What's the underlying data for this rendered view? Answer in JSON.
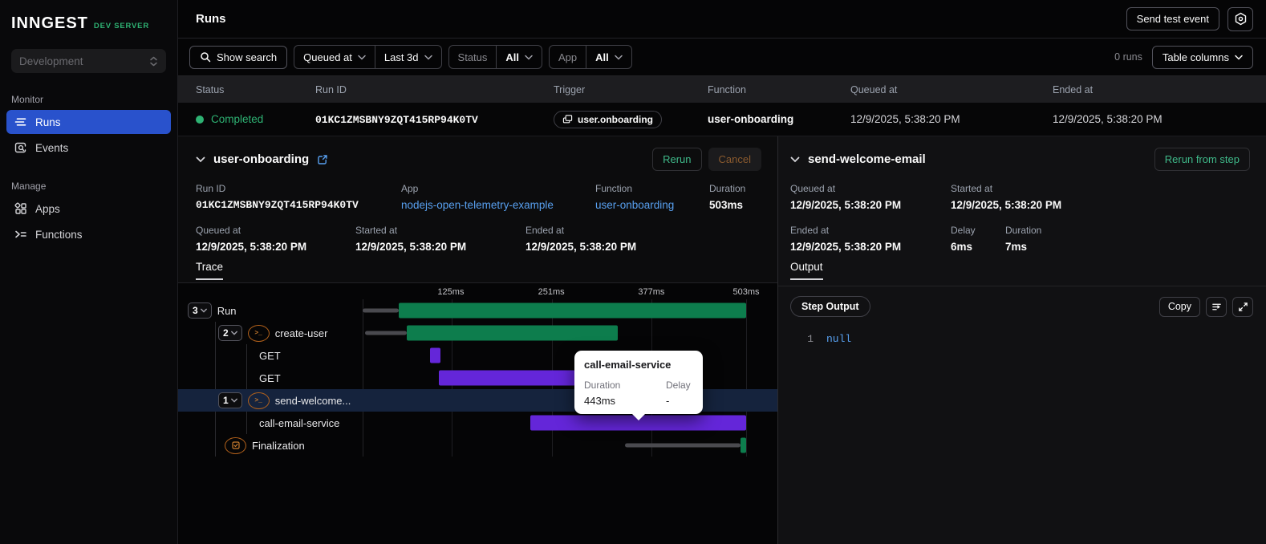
{
  "colors": {
    "accent_green": "#2eb273",
    "bar_green": "#0d7d4d",
    "bar_purple": "#6426d9",
    "link_blue": "#58a0f0",
    "active_blue": "#2952cc",
    "highlight_row": "#15233d"
  },
  "sidebar": {
    "logo": "INNGEST",
    "env": "DEV SERVER",
    "workspace": "Development",
    "sections": [
      {
        "label": "Monitor",
        "items": [
          {
            "label": "Runs",
            "active": true
          },
          {
            "label": "Events",
            "active": false
          }
        ]
      },
      {
        "label": "Manage",
        "items": [
          {
            "label": "Apps",
            "active": false
          },
          {
            "label": "Functions",
            "active": false
          }
        ]
      }
    ]
  },
  "topbar": {
    "title": "Runs",
    "send_test_event": "Send test event"
  },
  "filters": {
    "show_search": "Show search",
    "field": "Queued at",
    "range": "Last 3d",
    "status_label": "Status",
    "status_value": "All",
    "app_label": "App",
    "app_value": "All",
    "runs_count": "0 runs",
    "table_columns": "Table columns"
  },
  "table": {
    "columns": [
      "Status",
      "Run ID",
      "Trigger",
      "Function",
      "Queued at",
      "Ended at"
    ],
    "row": {
      "status": "Completed",
      "run_id": "01KC1ZMSBNY9ZQT415RP94K0TV",
      "trigger": "user.onboarding",
      "function": "user-onboarding",
      "queued_at": "12/9/2025, 5:38:20 PM",
      "ended_at": "12/9/2025, 5:38:20 PM"
    }
  },
  "run_details": {
    "title": "user-onboarding",
    "rerun": "Rerun",
    "cancel": "Cancel",
    "run_id_label": "Run ID",
    "run_id": "01KC1ZMSBNY9ZQT415RP94K0TV",
    "app_label": "App",
    "app": "nodejs-open-telemetry-example",
    "function_label": "Function",
    "function": "user-onboarding",
    "duration_label": "Duration",
    "duration": "503ms",
    "queued_label": "Queued at",
    "queued": "12/9/2025, 5:38:20 PM",
    "started_label": "Started at",
    "started": "12/9/2025, 5:38:20 PM",
    "ended_label": "Ended at",
    "ended": "12/9/2025, 5:38:20 PM",
    "tab": "Trace"
  },
  "trace": {
    "ticks": [
      {
        "label": "125ms",
        "pct": 23.0
      },
      {
        "label": "251ms",
        "pct": 49.2
      },
      {
        "label": "377ms",
        "pct": 75.3
      },
      {
        "label": "503ms",
        "pct": 100
      }
    ],
    "rows": [
      {
        "name": "Run",
        "depth": 0,
        "badge": "3",
        "icon": null,
        "highlight": false,
        "segments": [
          {
            "kind": "queue",
            "start": 0,
            "end": 9.4
          },
          {
            "kind": "green",
            "start": 9.4,
            "end": 100
          }
        ]
      },
      {
        "name": "create-user",
        "depth": 1,
        "badge": "2",
        "icon": "step",
        "highlight": false,
        "segments": [
          {
            "kind": "queue",
            "start": 0.6,
            "end": 11.5
          },
          {
            "kind": "green",
            "start": 11.5,
            "end": 66.5
          }
        ]
      },
      {
        "name": "GET",
        "depth": 2,
        "badge": null,
        "icon": null,
        "highlight": false,
        "segments": [
          {
            "kind": "purple",
            "start": 17.6,
            "end": 20.3
          }
        ]
      },
      {
        "name": "GET",
        "depth": 2,
        "badge": null,
        "icon": null,
        "highlight": false,
        "segments": [
          {
            "kind": "purple",
            "start": 19.9,
            "end": 55.4
          }
        ]
      },
      {
        "name": "send-welcome...",
        "depth": 1,
        "badge": "1",
        "icon": "step",
        "highlight": true,
        "segments": [
          {
            "kind": "green",
            "start": 68.8,
            "end": 72.0
          }
        ]
      },
      {
        "name": "call-email-service",
        "depth": 2,
        "badge": null,
        "icon": null,
        "highlight": false,
        "segments": [
          {
            "kind": "purple",
            "start": 43.7,
            "end": 100
          }
        ]
      },
      {
        "name": "Finalization",
        "depth": 1,
        "badge": null,
        "icon": "final",
        "highlight": false,
        "segments": [
          {
            "kind": "queue",
            "start": 68.4,
            "end": 98.5
          },
          {
            "kind": "green",
            "start": 98.5,
            "end": 100
          }
        ]
      }
    ],
    "tooltip": {
      "title": "call-email-service",
      "duration_label": "Duration",
      "duration": "443ms",
      "delay_label": "Delay",
      "delay": "-"
    }
  },
  "step_details": {
    "title": "send-welcome-email",
    "rerun_from_step": "Rerun from step",
    "queued_label": "Queued at",
    "queued": "12/9/2025, 5:38:20 PM",
    "started_label": "Started at",
    "started": "12/9/2025, 5:38:20 PM",
    "ended_label": "Ended at",
    "ended": "12/9/2025, 5:38:20 PM",
    "delay_label": "Delay",
    "delay": "6ms",
    "duration_label": "Duration",
    "duration": "7ms",
    "tab": "Output",
    "output_kind": "Step Output",
    "copy": "Copy",
    "code": {
      "line": "1",
      "value": "null"
    }
  }
}
